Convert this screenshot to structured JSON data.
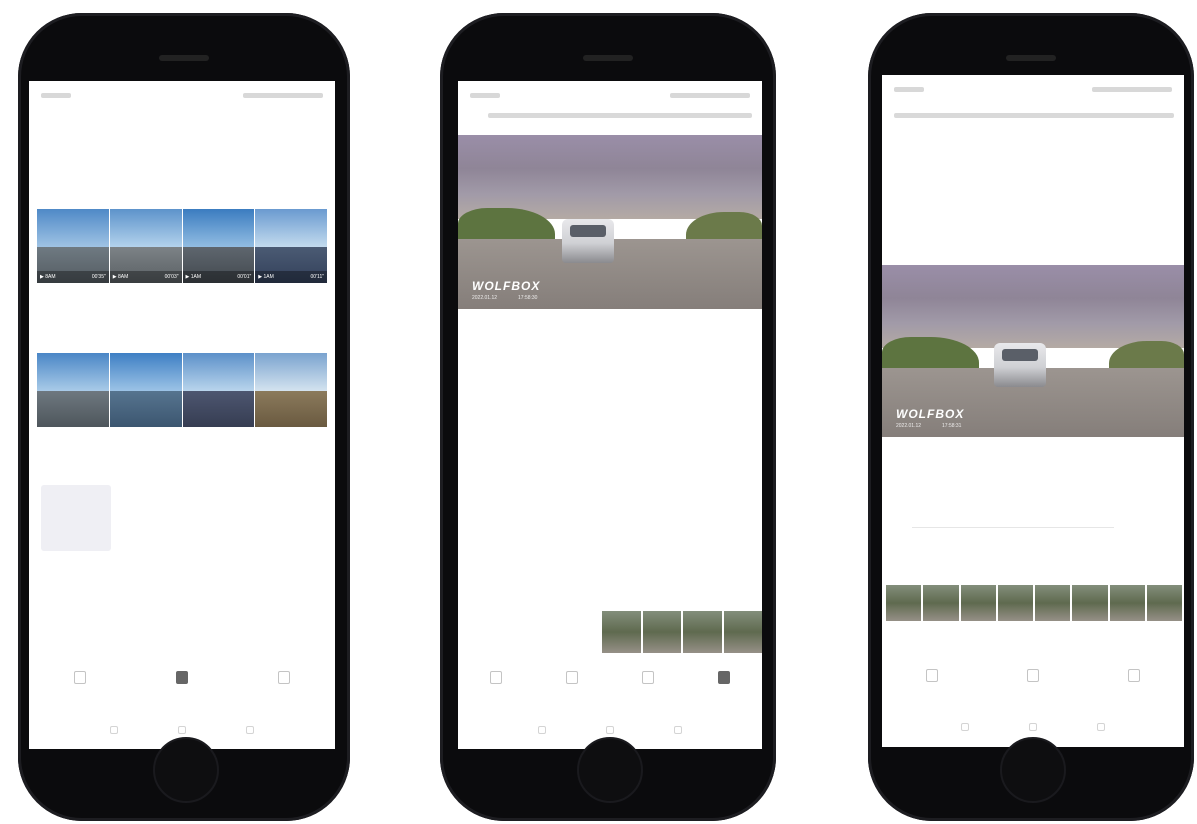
{
  "colors": {
    "screen_bg": "#ffffff",
    "phone_body": "#0b0b0d",
    "accent_dark": "#666666",
    "muted_text": "#b8b8b8"
  },
  "phone1": {
    "page_title": "",
    "sections": [
      {
        "title": "",
        "more": "",
        "thumbs": [
          {
            "badge": "▶ 8AM",
            "duration": "00'35\""
          },
          {
            "badge": "▶ 8AM",
            "duration": "00'03\""
          },
          {
            "badge": "▶ 1AM",
            "duration": "00'01\""
          },
          {
            "badge": "▶ 1AM",
            "duration": "00'11\""
          }
        ]
      },
      {
        "title": "",
        "more": ""
      },
      {
        "title": "",
        "more": ""
      }
    ],
    "tabs": [
      {
        "label": "",
        "icon": "video-icon"
      },
      {
        "label": "",
        "icon": "gallery-icon"
      },
      {
        "label": "",
        "icon": "settings-icon"
      }
    ]
  },
  "phone2": {
    "video": {
      "brand": "WOLFBOX",
      "date": "2022.01.12",
      "time": "17:58:30"
    },
    "clips": [
      {
        "time": ""
      },
      {
        "time": ""
      },
      {
        "time": ""
      },
      {
        "time": ""
      }
    ],
    "tabs": [
      {
        "label": "",
        "icon": "playback-icon"
      },
      {
        "label": "",
        "icon": "download-icon"
      },
      {
        "label": "",
        "icon": "camera-icon"
      },
      {
        "label": "",
        "icon": "record-icon"
      }
    ]
  },
  "phone3": {
    "video": {
      "brand": "WOLFBOX",
      "date": "2022.01.12",
      "time": "17:58:31"
    },
    "tabs": [
      {
        "label": "",
        "icon": "file-icon"
      },
      {
        "label": "",
        "icon": "share-icon"
      },
      {
        "label": "",
        "icon": "delete-icon"
      }
    ]
  }
}
